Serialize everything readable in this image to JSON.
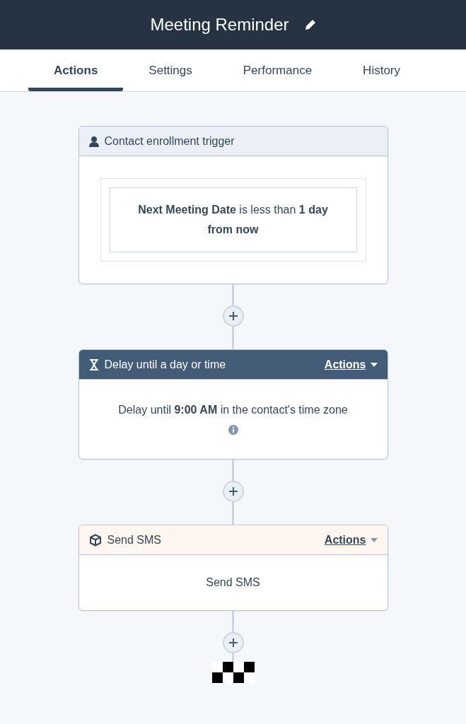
{
  "window": {
    "title": "Meeting Reminder"
  },
  "tabs": [
    {
      "label": "Actions",
      "selected": true
    },
    {
      "label": "Settings",
      "selected": false
    },
    {
      "label": "Performance",
      "selected": false
    },
    {
      "label": "History",
      "selected": false
    }
  ],
  "steps": [
    {
      "kind": "trigger",
      "title": "Contact enrollment trigger",
      "body": "**Next Meeting Date** is less than **1 day from now**"
    },
    {
      "kind": "delay",
      "title": "Delay until a day or time",
      "actions_menu": "Actions",
      "body": "Delay until **9:00 AM** in the contact's time zone"
    },
    {
      "kind": "action",
      "title": "Send SMS",
      "actions_menu": "Actions",
      "body": "Send SMS"
    }
  ]
}
